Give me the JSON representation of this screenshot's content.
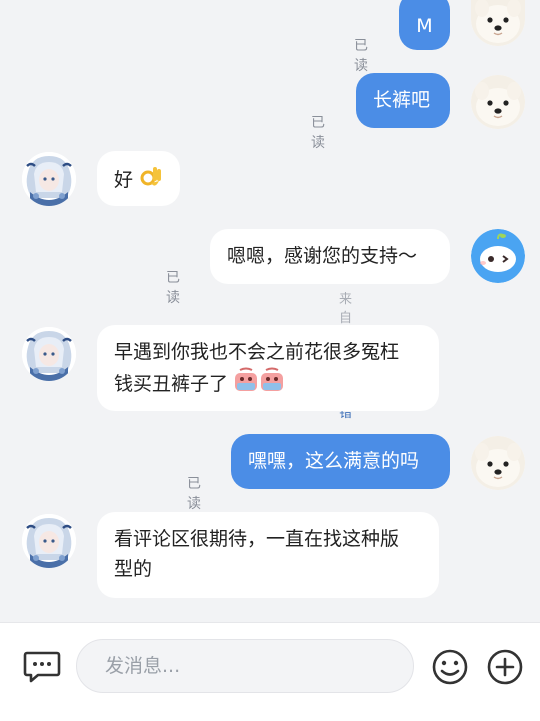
{
  "messages": [
    {
      "id": "m1",
      "text": "M",
      "read": "已读"
    },
    {
      "id": "m2",
      "text": "长裤吧",
      "read": "已读"
    },
    {
      "id": "m3",
      "text": "好"
    },
    {
      "id": "m4",
      "text": "嗯嗯，感谢您的支持～",
      "read": "已读",
      "source": "来自知识库",
      "correct": "纠错"
    },
    {
      "id": "m5",
      "line1": "早遇到你我也不会之前花很多冤枉",
      "line2": "钱买丑裤子了"
    },
    {
      "id": "m6",
      "text": "嘿嘿，这么满意的吗",
      "read": "已读"
    },
    {
      "id": "m7",
      "line1": "看评论区很期待，一直在找这种版",
      "line2": "型的"
    }
  ],
  "input": {
    "placeholder": "发消息..."
  },
  "icons": {
    "left": "chat-bubble-icon",
    "emoji": "smiley-icon",
    "plus": "plus-circle-icon"
  },
  "colors": {
    "outgoing": "#4b8de6",
    "incoming": "#ffffff",
    "background": "#f2f3f5"
  }
}
